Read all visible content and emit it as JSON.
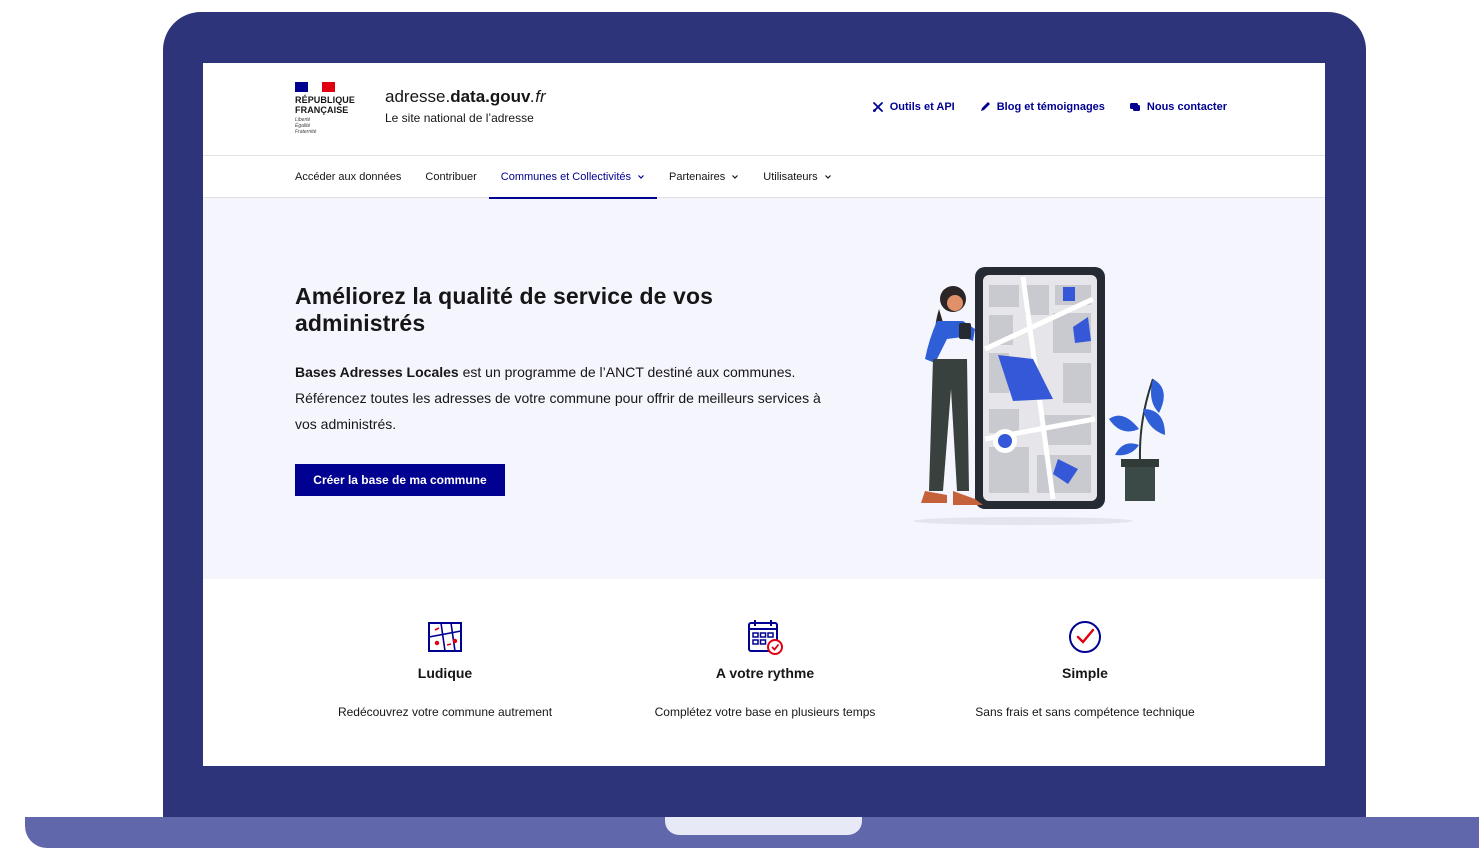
{
  "header": {
    "rf_lines": [
      "RÉPUBLIQUE",
      "FRANÇAISE"
    ],
    "devise": [
      "Liberté",
      "Égalité",
      "Fraternité"
    ],
    "site_title_pre": "adresse.",
    "site_title_bold": "data.gouv",
    "site_title_suffix": ".fr",
    "tagline": "Le site national de l’adresse",
    "tools": [
      {
        "label": "Outils et API",
        "icon": "tools-icon"
      },
      {
        "label": "Blog et témoignages",
        "icon": "pen-icon"
      },
      {
        "label": "Nous contacter",
        "icon": "chat-icon"
      }
    ]
  },
  "nav": {
    "items": [
      {
        "label": "Accéder aux données"
      },
      {
        "label": "Contribuer"
      },
      {
        "label": "Communes et Collectivités"
      },
      {
        "label": "Partenaires"
      },
      {
        "label": "Utilisateurs"
      }
    ]
  },
  "hero": {
    "title": "Améliorez la qualité de service de vos administrés",
    "desc_bold": "Bases Adresses Locales",
    "desc_rest": " est un programme de l’ANCT destiné aux communes. Référencez toutes les adresses de votre commune pour offrir de meilleurs services à vos administrés.",
    "cta": "Créer la base de ma commune"
  },
  "features": [
    {
      "title": "Ludique",
      "desc": "Redécouvrez votre commune autrement",
      "icon": "map-icon"
    },
    {
      "title": "A votre rythme",
      "desc": "Complétez votre base en plusieurs temps",
      "icon": "calendar-icon"
    },
    {
      "title": "Simple",
      "desc": "Sans frais et sans compétence technique",
      "icon": "check-circle-icon"
    }
  ],
  "colors": {
    "brand": "#000091",
    "laptop_frame": "#2d3479",
    "laptop_base": "#6167ab",
    "hero_bg": "#f5f5fe",
    "accent_red": "#e1000f"
  }
}
